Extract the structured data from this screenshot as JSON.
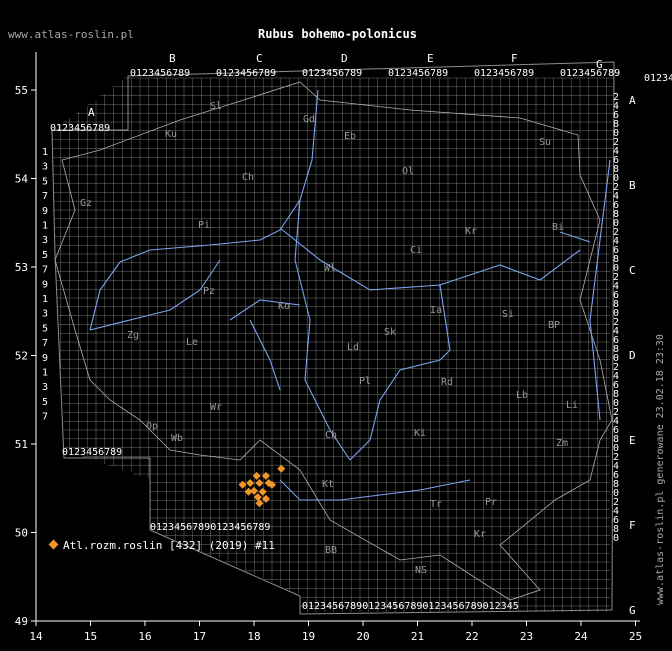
{
  "header": {
    "site": "www.atlas-roslin.pl",
    "title": "Rubus bohemo-polonicus"
  },
  "footer_note": "www.atlas-roslin.pl generowane 23.02.18 23:30",
  "legend": {
    "label": "Atl.rozm.roslin [432] (2019) #11"
  },
  "colors": {
    "background": "#000000",
    "grid": "#8a8a8a",
    "border": "#8c8c8c",
    "rivers": "#7aa4f0",
    "marker": "#f0962a",
    "axis_text": "#ffffff"
  },
  "chart_data": {
    "type": "scatter",
    "projection": "lon-lat",
    "x_axis": {
      "ticks": [
        14,
        15,
        16,
        17,
        18,
        19,
        20,
        21,
        22,
        23,
        24,
        25
      ],
      "range": [
        14,
        25
      ]
    },
    "y_axis": {
      "ticks": [
        49,
        50,
        51,
        52,
        53,
        54,
        55
      ],
      "range": [
        49,
        55.6
      ]
    },
    "grid_column_letters": [
      "A",
      "B",
      "C",
      "D",
      "E",
      "F",
      "G"
    ],
    "grid_row_letters_right": [
      "A",
      "B",
      "C",
      "D",
      "E",
      "F",
      "G"
    ],
    "grid_digits": "0123456789",
    "right_digits": [
      "2",
      "4",
      "6",
      "8",
      "0",
      "2",
      "4",
      "6",
      "8",
      "0"
    ],
    "region_labels": [
      "Sl",
      "Gd",
      "Eb",
      "Ku",
      "Su",
      "Ol",
      "Ch",
      "Bi",
      "Pi",
      "Ci",
      "Kr",
      "Gz",
      "Wl",
      "Pz",
      "Ko",
      "Ia",
      "Zg",
      "Ld",
      "Sk",
      "Le",
      "Si",
      "BP",
      "Pl",
      "Rd",
      "Lb",
      "Li",
      "Wr",
      "Ki",
      "Ch",
      "Wb",
      "Op",
      "Zm",
      "Kt",
      "Tr",
      "Pr",
      "Kr",
      "NS",
      "BB"
    ],
    "series": [
      {
        "name": "Atl.rozm.roslin [432] (2019) #11",
        "points": [
          [
            18.05,
            50.64
          ],
          [
            18.22,
            50.64
          ],
          [
            17.93,
            50.56
          ],
          [
            18.1,
            50.56
          ],
          [
            18.27,
            50.56
          ],
          [
            18.5,
            50.72
          ],
          [
            17.79,
            50.54
          ],
          [
            18.0,
            50.47
          ],
          [
            18.16,
            50.46
          ],
          [
            18.33,
            50.54
          ],
          [
            17.9,
            50.46
          ],
          [
            18.07,
            50.4
          ],
          [
            18.22,
            50.38
          ],
          [
            18.1,
            50.33
          ]
        ]
      }
    ]
  }
}
